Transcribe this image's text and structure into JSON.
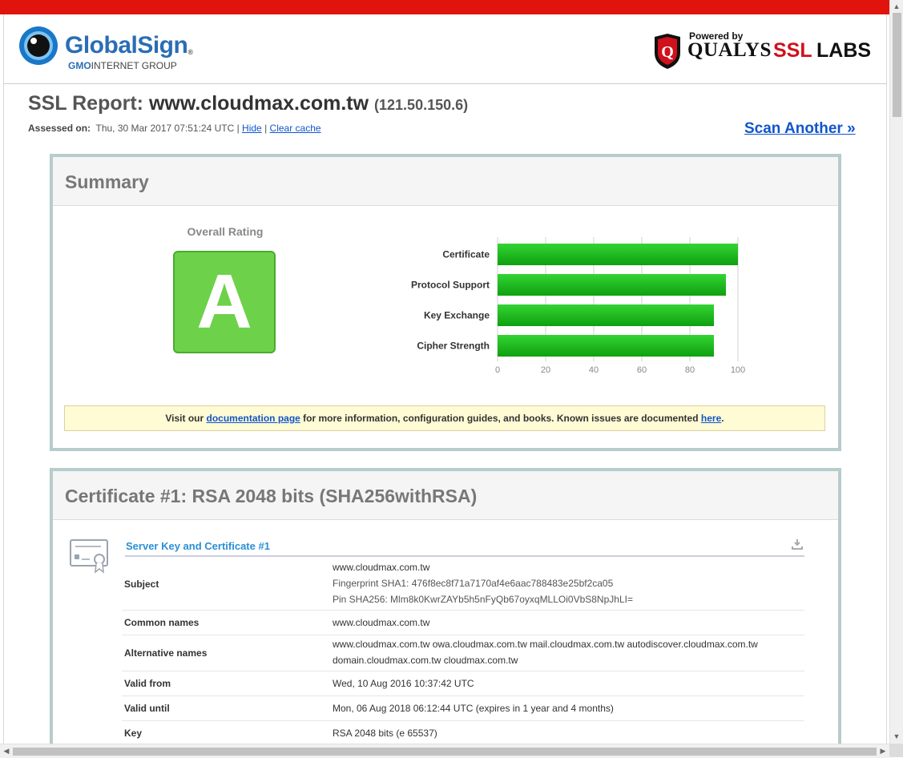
{
  "header": {
    "globalsign_name": "GlobalSign",
    "globalsign_sub_gmo": "GMO",
    "globalsign_sub_rest": "INTERNET GROUP",
    "powered_by": "Powered by",
    "qualys": "QUALYS",
    "ssl": "SSL",
    "labs": "LABS"
  },
  "report": {
    "title_prefix": "SSL Report:",
    "host": "www.cloudmax.com.tw",
    "ip": "(121.50.150.6)",
    "assessed_label": "Assessed on:",
    "assessed_value": "Thu, 30 Mar 2017 07:51:24 UTC |",
    "hide_link": "Hide",
    "separator": "|",
    "clear_cache_link": "Clear cache",
    "scan_another": "Scan Another »"
  },
  "summary": {
    "title": "Summary",
    "overall_label": "Overall Rating",
    "grade": "A",
    "notice_pre": "Visit our ",
    "notice_link1": "documentation page",
    "notice_mid": " for more information, configuration guides, and books. Known issues are documented ",
    "notice_link2": "here",
    "notice_post": "."
  },
  "chart_data": {
    "type": "bar",
    "orientation": "horizontal",
    "categories": [
      "Certificate",
      "Protocol Support",
      "Key Exchange",
      "Cipher Strength"
    ],
    "values": [
      100,
      95,
      90,
      90
    ],
    "xlim": [
      0,
      100
    ],
    "xticks": [
      0,
      20,
      40,
      60,
      80,
      100
    ],
    "grid": true,
    "bar_color": "#1db81d"
  },
  "certificate": {
    "title": "Certificate #1: RSA 2048 bits (SHA256withRSA)",
    "section_title": "Server Key and Certificate #1",
    "rows": [
      {
        "key": "Subject",
        "lines": [
          "www.cloudmax.com.tw",
          "Fingerprint SHA1: 476f8ec8f71a7170af4e6aac788483e25bf2ca05",
          "Pin SHA256: Mlm8k0KwrZAYb5h5nFyQb67oyxqMLLOi0VbS8NpJhLI="
        ]
      },
      {
        "key": "Common names",
        "lines": [
          "www.cloudmax.com.tw"
        ]
      },
      {
        "key": "Alternative names",
        "lines": [
          "www.cloudmax.com.tw owa.cloudmax.com.tw mail.cloudmax.com.tw autodiscover.cloudmax.com.tw",
          "domain.cloudmax.com.tw cloudmax.com.tw"
        ]
      },
      {
        "key": "Valid from",
        "lines": [
          "Wed, 10 Aug 2016 10:37:42 UTC"
        ]
      },
      {
        "key": "Valid until",
        "lines": [
          "Mon, 06 Aug 2018 06:12:44 UTC (expires in 1 year and 4 months)"
        ]
      },
      {
        "key": "Key",
        "lines": [
          "RSA 2048 bits (e 65537)"
        ]
      }
    ]
  },
  "colors": {
    "top_bar": "#e0140c",
    "grade_green": "#6dd14a",
    "link_blue": "#1155cc",
    "section_blue": "#2a8fd4"
  }
}
